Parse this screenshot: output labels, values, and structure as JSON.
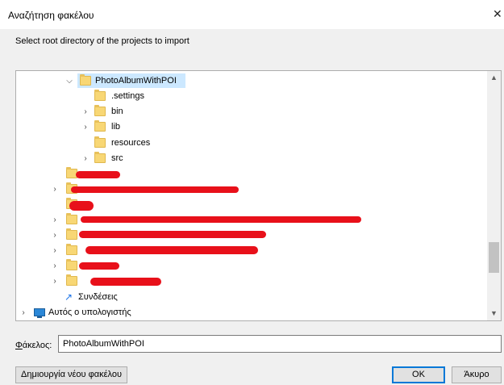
{
  "dialog": {
    "title": "Αναζήτηση φακέλου",
    "close_glyph": "✕",
    "instruction": "Select root directory of the projects to import"
  },
  "tree": {
    "selected_label": "PhotoAlbumWithPOI",
    "items": [
      {
        "label": "PhotoAlbumWithPOI",
        "expander": "expanded",
        "selected": true
      },
      {
        "label": ".settings",
        "expander": "none"
      },
      {
        "label": "bin",
        "expander": "collapsed"
      },
      {
        "label": "lib",
        "expander": "collapsed"
      },
      {
        "label": "resources",
        "expander": "none"
      },
      {
        "label": "src",
        "expander": "collapsed"
      },
      {
        "label": "",
        "redacted": true
      },
      {
        "label": "",
        "redacted": true
      },
      {
        "label": "",
        "redacted": true
      },
      {
        "label": "",
        "redacted": true
      },
      {
        "label": "",
        "redacted": true
      },
      {
        "label": "",
        "redacted": true
      },
      {
        "label": "",
        "redacted": true
      },
      {
        "label": "",
        "redacted": true
      },
      {
        "label": "Συνδέσεις",
        "icon": "shortcut-arrow-icon"
      },
      {
        "label": "Αυτός ο υπολογιστής",
        "icon": "computer-icon",
        "expander": "collapsed"
      }
    ],
    "scroll_position": 0.75
  },
  "folder_field": {
    "label_prefix": "Φ",
    "label_rest": "άκελος:",
    "value": "PhotoAlbumWithPOI"
  },
  "buttons": {
    "new_folder": "Δημιουργία νέου φακέλου",
    "ok": "OK",
    "cancel": "Άκυρο"
  },
  "colors": {
    "selection": "#cce8ff",
    "folder": "#f8d775",
    "redaction": "#e8101a",
    "default_button_border": "#0078d7"
  }
}
